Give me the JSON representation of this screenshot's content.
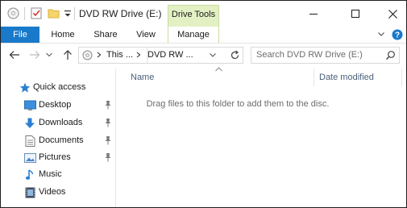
{
  "titlebar": {
    "title": "DVD RW Drive (E:)",
    "context_group": "Drive Tools",
    "icons": [
      "drive-icon",
      "properties-checkbox-icon",
      "new-folder-icon",
      "customize-dropdown-icon"
    ],
    "window_controls": [
      "minimize-icon",
      "maximize-icon",
      "close-icon"
    ]
  },
  "ribbon": {
    "tabs": [
      {
        "label": "File"
      },
      {
        "label": "Home"
      },
      {
        "label": "Share"
      },
      {
        "label": "View"
      },
      {
        "label": "Manage"
      }
    ]
  },
  "navbar": {
    "breadcrumb": [
      "This ...",
      "DVD RW ..."
    ],
    "search_placeholder": "Search DVD RW Drive (E:)"
  },
  "sidebar": {
    "items": [
      {
        "label": "Quick access",
        "icon": "star-icon",
        "pinned": false
      },
      {
        "label": "Desktop",
        "icon": "desktop-folder-icon",
        "pinned": true
      },
      {
        "label": "Downloads",
        "icon": "downloads-arrow-icon",
        "pinned": true
      },
      {
        "label": "Documents",
        "icon": "documents-icon",
        "pinned": true
      },
      {
        "label": "Pictures",
        "icon": "pictures-icon",
        "pinned": true
      },
      {
        "label": "Music",
        "icon": "music-note-icon",
        "pinned": false
      },
      {
        "label": "Videos",
        "icon": "videos-icon",
        "pinned": false
      }
    ]
  },
  "content": {
    "columns": [
      "Name",
      "Date modified"
    ],
    "empty_message": "Drag files to this folder to add them to the disc."
  },
  "colors": {
    "file_tab": "#1979ca",
    "context_tab": "#e3f0c4",
    "column_header_text": "#4c607a",
    "help": "#1979ca",
    "frame": "#1f1f1f"
  }
}
